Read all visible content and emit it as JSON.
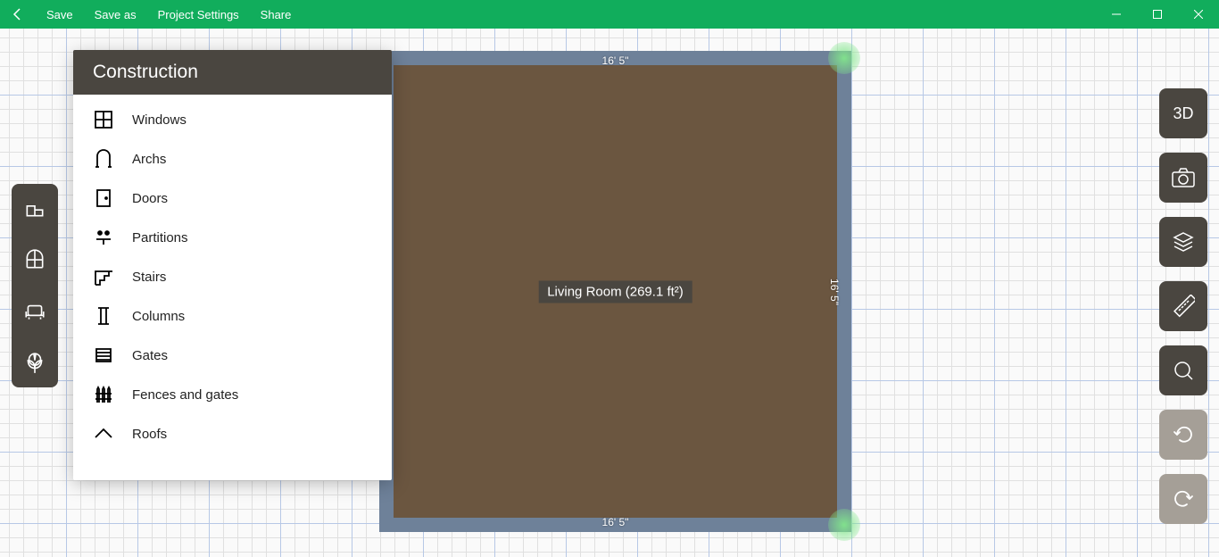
{
  "titlebar": {
    "save": "Save",
    "save_as": "Save as",
    "project_settings": "Project Settings",
    "share": "Share"
  },
  "panel": {
    "title": "Construction",
    "items": [
      {
        "label": "Windows",
        "icon": "window-icon"
      },
      {
        "label": "Archs",
        "icon": "arch-icon"
      },
      {
        "label": "Doors",
        "icon": "door-icon"
      },
      {
        "label": "Partitions",
        "icon": "partition-icon"
      },
      {
        "label": "Stairs",
        "icon": "stairs-icon"
      },
      {
        "label": "Columns",
        "icon": "column-icon"
      },
      {
        "label": "Gates",
        "icon": "gate-icon"
      },
      {
        "label": "Fences and gates",
        "icon": "fence-icon"
      },
      {
        "label": "Roofs",
        "icon": "roof-icon"
      }
    ]
  },
  "room": {
    "label": "Living Room (269.1 ft²)",
    "dim_top": "16' 5\"",
    "dim_bottom": "16' 5\"",
    "dim_right": "16' 5\""
  },
  "right_toolbar": {
    "view3d": "3D"
  },
  "colors": {
    "accent": "#11ad5c",
    "toolbar": "#4a4640",
    "room_fill": "#6b5640",
    "wall": "#6e8199"
  }
}
